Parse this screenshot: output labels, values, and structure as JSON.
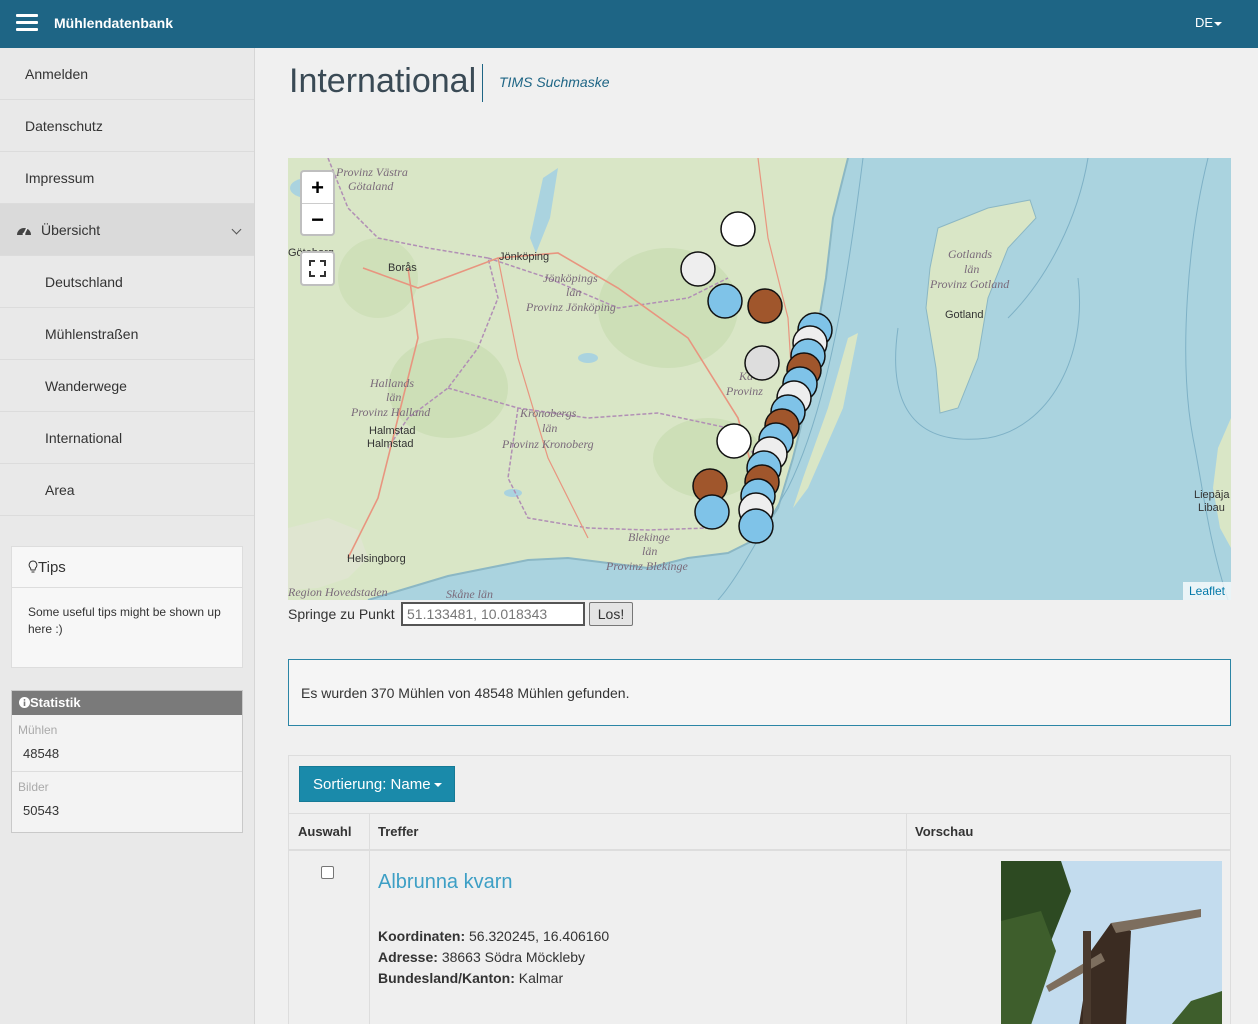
{
  "topbar": {
    "brand": "Mühlendatenbank",
    "lang": "DE"
  },
  "sidebar": {
    "items": [
      {
        "label": "Anmelden"
      },
      {
        "label": "Datenschutz"
      },
      {
        "label": "Impressum"
      },
      {
        "label": "Übersicht"
      },
      {
        "label": "Deutschland"
      },
      {
        "label": "Mühlenstraßen"
      },
      {
        "label": "Wanderwege"
      },
      {
        "label": "International"
      },
      {
        "label": "Area"
      }
    ],
    "tips": {
      "title": "Tips",
      "text": "Some useful tips might be shown up here :)"
    },
    "stats": {
      "title": "Statistik",
      "mills_label": "Mühlen",
      "mills_value": "48548",
      "images_label": "Bilder",
      "images_value": "50543"
    }
  },
  "main": {
    "title": "International",
    "subtitle": "TIMS Suchmaske",
    "map": {
      "zoom_in": "+",
      "zoom_out": "−",
      "attribution": "Leaflet",
      "labels": {
        "vastra": "Provinz Västra",
        "gotaland": "Götaland",
        "goteborg": "Göteborg",
        "boras": "Borås",
        "jonkoping": "Jönköping",
        "jonkopings": "Jönköpings",
        "lan": "län",
        "prov_jonkoping": "Provinz Jönköping",
        "hallands": "Hallands",
        "prov_halland": "Provinz Halland",
        "halmstad": "Halmstad",
        "kronobergs": "Kronobergs",
        "prov_kronoberg": "Provinz Kronoberg",
        "ka": "Ka",
        "provinz": "Provinz",
        "blekinge": "Blekinge",
        "prov_blekinge": "Provinz Blekinge",
        "helsingborg": "Helsingborg",
        "hovedstaden": "Region Hovedstaden",
        "skane": "Skåne län",
        "gotlands": "Gotlands",
        "prov_gotland": "Provinz Gotland",
        "gotland": "Gotland",
        "liepaja": "Liepāja",
        "libau": "Libau"
      }
    },
    "jump": {
      "label": "Springe zu Punkt",
      "value": "51.133481, 10.018343",
      "button": "Los!"
    },
    "result_text": "Es wurden 370 Mühlen von 48548 Mühlen gefunden.",
    "sort_label": "Sortierung: Name",
    "table": {
      "headers": [
        "Auswahl",
        "Treffer",
        "Vorschau"
      ],
      "rows": [
        {
          "name": "Albrunna kvarn",
          "coords_label": "Koordinaten:",
          "coords": "56.320245, 16.406160",
          "address_label": "Adresse:",
          "address": "38663 Södra Möckleby",
          "state_label": "Bundesland/Kanton:",
          "state": "Kalmar"
        }
      ]
    }
  },
  "colors": {
    "topbar": "#1e6585",
    "accent": "#1a8aaa",
    "link": "#3d9fc5"
  }
}
